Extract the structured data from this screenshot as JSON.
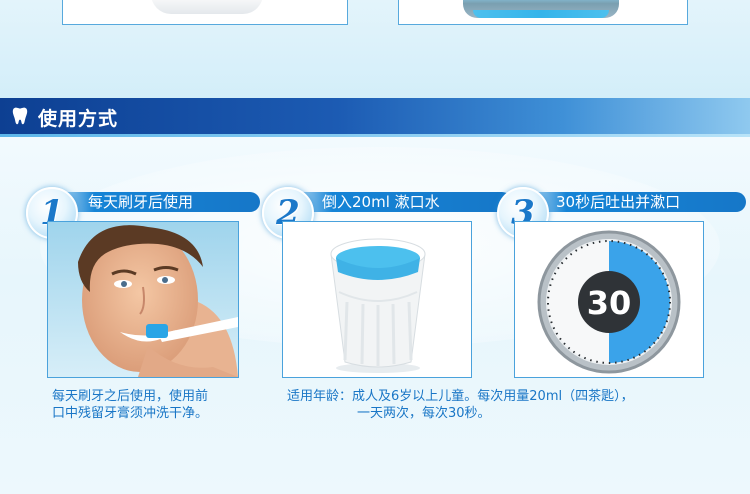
{
  "header": {
    "title": "使用方式"
  },
  "steps": [
    {
      "number": "1",
      "label": "每天刷牙后使用"
    },
    {
      "number": "2",
      "label": "倒入20ml 漱口水"
    },
    {
      "number": "3",
      "label": "30秒后吐出并漱口",
      "timer_value": "30"
    }
  ],
  "descriptions": {
    "step1": [
      "每天刷牙之后使用，使用前",
      "口中残留牙膏须冲洗干净。"
    ],
    "step2": [
      "适用年龄：成人及6岁以上儿童。每次用量20ml（四茶匙），",
      "一天两次，每次30秒。"
    ]
  },
  "colors": {
    "accent": "#1976c6",
    "header_dark": "#0d3f92",
    "liquid": "#4cc0ee"
  }
}
